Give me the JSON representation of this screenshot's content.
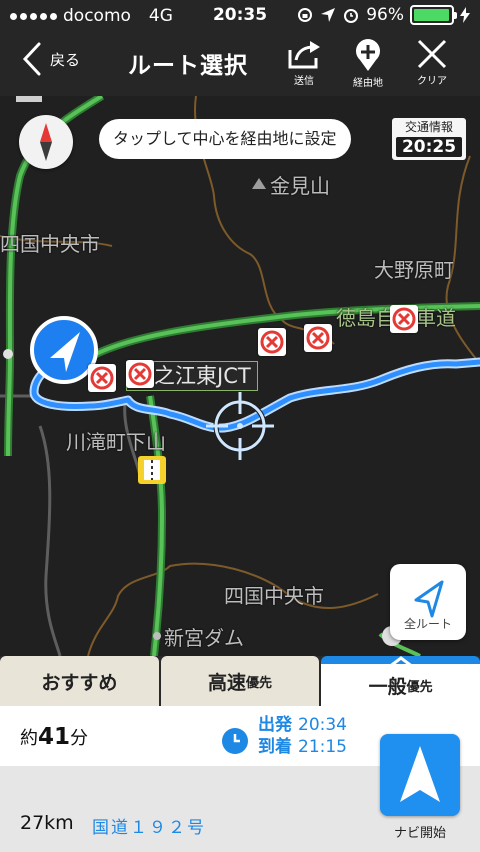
{
  "status_bar": {
    "carrier": "docomo",
    "network": "4G",
    "time": "20:35",
    "battery": "96%",
    "battery_level": 0.96
  },
  "header": {
    "back_label": "戻る",
    "title": "ルート選択",
    "send_label": "送信",
    "waypoint_label": "経由地",
    "clear_label": "クリア"
  },
  "map": {
    "hint": "タップして中心を経由地に設定",
    "traffic_label": "交通情報",
    "traffic_time": "20:25",
    "labels": {
      "kanamiyama": "金見山",
      "shikoku_chuo_top": "四国中央市",
      "ono_bara": "大野原町",
      "expressway": "徳島自動車道",
      "kawanoe_jct": "川之江東JCT",
      "kawataki": "川滝町下山",
      "shikoku_chuo_bottom": "四国中央市",
      "shingu_dam": "新宮ダム"
    },
    "all_route_label": "全ルート"
  },
  "tabs": {
    "recommended": "おすすめ",
    "highway": "高速",
    "highway_suffix": "優先",
    "general": "一般",
    "general_suffix": "優先"
  },
  "summary": {
    "duration_prefix": "約",
    "duration_value": "41",
    "duration_unit": "分",
    "depart_label": "出発",
    "depart_time": "20:34",
    "arrive_label": "到着",
    "arrive_time": "21:15",
    "distance": "27km",
    "road": "国道１９２号",
    "navi_label": "ナビ開始"
  },
  "colors": {
    "route_blue": "#2f8fff",
    "accent": "#1e88e5",
    "expressway_green": "#5bbf5b",
    "closure_red": "#e53935"
  }
}
